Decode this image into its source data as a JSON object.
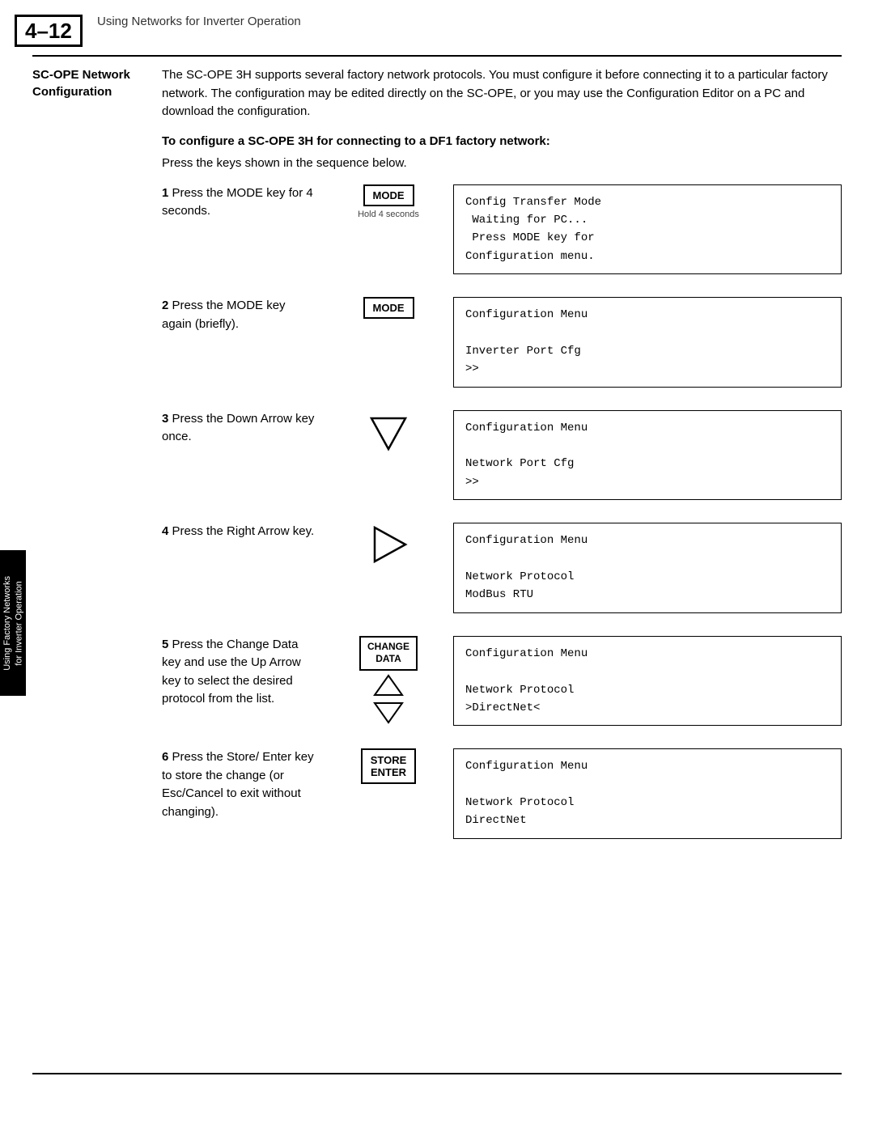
{
  "page": {
    "number": "4–12",
    "header_title": "Using Networks for Inverter Operation"
  },
  "side_tab": {
    "line1": "Using Factory Networks",
    "line2": "for Inverter Operation"
  },
  "section": {
    "label_line1": "SC-OPE Network",
    "label_line2": "Configuration",
    "intro_text": "The SC-OPE 3H supports several factory network protocols. You must configure it before connecting it to a particular factory network. The configuration may be edited directly on the SC-OPE, or you may use the Configuration Editor on a PC and download the configuration.",
    "sub_heading": "To configure a SC-OPE 3H for connecting to a DF1 factory network:",
    "press_note": "Press the keys shown in the sequence below."
  },
  "steps": [
    {
      "num": "1",
      "text": "Press the MODE key for 4 seconds.",
      "key": "MODE",
      "key_sub": "Hold 4 seconds",
      "key_type": "button",
      "screen_lines": [
        "Config Transfer Mode",
        " Waiting for PC...",
        " Press MODE key for",
        "Configuration menu."
      ]
    },
    {
      "num": "2",
      "text": "Press the MODE key again (briefly).",
      "key": "MODE",
      "key_sub": "",
      "key_type": "button",
      "screen_lines": [
        "Configuration Menu",
        "",
        "Inverter Port Cfg",
        ">>"
      ]
    },
    {
      "num": "3",
      "text": "Press the Down Arrow key once.",
      "key": "down_arrow",
      "key_sub": "",
      "key_type": "arrow_down",
      "screen_lines": [
        "Configuration Menu",
        "",
        "Network Port Cfg",
        ">>"
      ]
    },
    {
      "num": "4",
      "text": "Press the Right Arrow key.",
      "key": "right_arrow",
      "key_sub": "",
      "key_type": "arrow_right",
      "screen_lines": [
        "Configuration Menu",
        "",
        "Network Protocol",
        "ModBus RTU"
      ]
    },
    {
      "num": "5",
      "text": "Press the Change Data key and use the Up Arrow key to select the desired protocol from the list.",
      "key": "CHANGE DATA",
      "key_sub": "",
      "key_type": "change_data",
      "screen_lines": [
        "Configuration Menu",
        "",
        "Network Protocol",
        ">DirectNet<"
      ]
    },
    {
      "num": "6",
      "text": "Press the Store/ Enter key to store the change (or Esc/Cancel to exit without changing).",
      "key1": "STORE",
      "key2": "ENTER",
      "key_sub": "",
      "key_type": "button2",
      "screen_lines": [
        "Configuration Menu",
        "",
        "Network Protocol",
        "DirectNet"
      ]
    }
  ]
}
